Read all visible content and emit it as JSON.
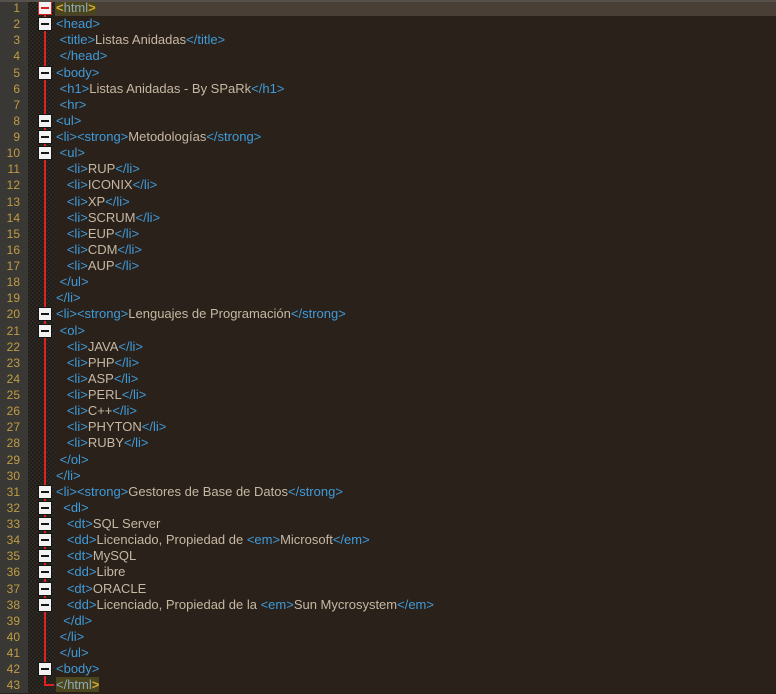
{
  "editor": {
    "language": "HTML",
    "total_lines": 43,
    "colors": {
      "background": "#2A211B",
      "current_line_background": "#4A3F36",
      "gutter_background": "#3A3834",
      "line_number_color": "#BF9D43",
      "tag_color": "#3F9BD9",
      "text_color": "#C6B8A2",
      "fold_guide_red": "#DE2222",
      "matched_tag_background": "#4A451C",
      "matched_tag_bracket_color": "#D2A92F",
      "matched_tag_name_color": "#8FA9BA",
      "top_edge_color": "#57514B"
    },
    "icons": {
      "fold_collapse_icon": "minus-box",
      "fold_guide_icon": "vertical-line",
      "fold_tail_icon": "corner-line"
    },
    "lines": [
      {
        "n": 1,
        "fold": "boxRed",
        "current": true,
        "segments": [
          {
            "t": "<",
            "c": "mb"
          },
          {
            "t": "html",
            "c": "mn"
          },
          {
            "t": ">",
            "c": "mb"
          }
        ]
      },
      {
        "n": 2,
        "fold": "box",
        "segments": [
          {
            "t": "<head>",
            "c": "tag"
          }
        ]
      },
      {
        "n": 3,
        "fold": "line",
        "segments": [
          {
            "t": " ",
            "c": "txt"
          },
          {
            "t": "<title>",
            "c": "tag"
          },
          {
            "t": "Listas Anidadas",
            "c": "txt"
          },
          {
            "t": "</title>",
            "c": "tag"
          }
        ]
      },
      {
        "n": 4,
        "fold": "line",
        "segments": [
          {
            "t": " ",
            "c": "txt"
          },
          {
            "t": "</head>",
            "c": "tag"
          }
        ]
      },
      {
        "n": 5,
        "fold": "box",
        "segments": [
          {
            "t": "<body>",
            "c": "tag"
          }
        ]
      },
      {
        "n": 6,
        "fold": "line",
        "segments": [
          {
            "t": " ",
            "c": "txt"
          },
          {
            "t": "<h1>",
            "c": "tag"
          },
          {
            "t": "Listas Anidadas - By SPaRk",
            "c": "txt"
          },
          {
            "t": "</h1>",
            "c": "tag"
          }
        ]
      },
      {
        "n": 7,
        "fold": "line",
        "segments": [
          {
            "t": " ",
            "c": "txt"
          },
          {
            "t": "<hr>",
            "c": "tag"
          }
        ]
      },
      {
        "n": 8,
        "fold": "box",
        "segments": [
          {
            "t": "<ul>",
            "c": "tag"
          }
        ]
      },
      {
        "n": 9,
        "fold": "box",
        "segments": [
          {
            "t": "<li><strong>",
            "c": "tag"
          },
          {
            "t": "Metodologías",
            "c": "txt"
          },
          {
            "t": "</strong>",
            "c": "tag"
          }
        ]
      },
      {
        "n": 10,
        "fold": "box",
        "segments": [
          {
            "t": " ",
            "c": "txt"
          },
          {
            "t": "<ul>",
            "c": "tag"
          }
        ]
      },
      {
        "n": 11,
        "fold": "line",
        "segments": [
          {
            "t": "   ",
            "c": "txt"
          },
          {
            "t": "<li>",
            "c": "tag"
          },
          {
            "t": "RUP",
            "c": "txt"
          },
          {
            "t": "</li>",
            "c": "tag"
          }
        ]
      },
      {
        "n": 12,
        "fold": "line",
        "segments": [
          {
            "t": "   ",
            "c": "txt"
          },
          {
            "t": "<li>",
            "c": "tag"
          },
          {
            "t": "ICONIX",
            "c": "txt"
          },
          {
            "t": "</li>",
            "c": "tag"
          }
        ]
      },
      {
        "n": 13,
        "fold": "line",
        "segments": [
          {
            "t": "   ",
            "c": "txt"
          },
          {
            "t": "<li>",
            "c": "tag"
          },
          {
            "t": "XP",
            "c": "txt"
          },
          {
            "t": "</li>",
            "c": "tag"
          }
        ]
      },
      {
        "n": 14,
        "fold": "line",
        "segments": [
          {
            "t": "   ",
            "c": "txt"
          },
          {
            "t": "<li>",
            "c": "tag"
          },
          {
            "t": "SCRUM",
            "c": "txt"
          },
          {
            "t": "</li>",
            "c": "tag"
          }
        ]
      },
      {
        "n": 15,
        "fold": "line",
        "segments": [
          {
            "t": "   ",
            "c": "txt"
          },
          {
            "t": "<li>",
            "c": "tag"
          },
          {
            "t": "EUP",
            "c": "txt"
          },
          {
            "t": "</li>",
            "c": "tag"
          }
        ]
      },
      {
        "n": 16,
        "fold": "line",
        "segments": [
          {
            "t": "   ",
            "c": "txt"
          },
          {
            "t": "<li>",
            "c": "tag"
          },
          {
            "t": "CDM",
            "c": "txt"
          },
          {
            "t": "</li>",
            "c": "tag"
          }
        ]
      },
      {
        "n": 17,
        "fold": "line",
        "segments": [
          {
            "t": "   ",
            "c": "txt"
          },
          {
            "t": "<li>",
            "c": "tag"
          },
          {
            "t": "AUP",
            "c": "txt"
          },
          {
            "t": "</li>",
            "c": "tag"
          }
        ]
      },
      {
        "n": 18,
        "fold": "line",
        "segments": [
          {
            "t": " ",
            "c": "txt"
          },
          {
            "t": "</ul>",
            "c": "tag"
          }
        ]
      },
      {
        "n": 19,
        "fold": "line",
        "segments": [
          {
            "t": "</li>",
            "c": "tag"
          }
        ]
      },
      {
        "n": 20,
        "fold": "box",
        "segments": [
          {
            "t": "<li><strong>",
            "c": "tag"
          },
          {
            "t": "Lenguajes de Programación",
            "c": "txt"
          },
          {
            "t": "</strong>",
            "c": "tag"
          }
        ]
      },
      {
        "n": 21,
        "fold": "box",
        "segments": [
          {
            "t": " ",
            "c": "txt"
          },
          {
            "t": "<ol>",
            "c": "tag"
          }
        ]
      },
      {
        "n": 22,
        "fold": "line",
        "segments": [
          {
            "t": "   ",
            "c": "txt"
          },
          {
            "t": "<li>",
            "c": "tag"
          },
          {
            "t": "JAVA",
            "c": "txt"
          },
          {
            "t": "</li>",
            "c": "tag"
          }
        ]
      },
      {
        "n": 23,
        "fold": "line",
        "segments": [
          {
            "t": "   ",
            "c": "txt"
          },
          {
            "t": "<li>",
            "c": "tag"
          },
          {
            "t": "PHP",
            "c": "txt"
          },
          {
            "t": "</li>",
            "c": "tag"
          }
        ]
      },
      {
        "n": 24,
        "fold": "line",
        "segments": [
          {
            "t": "   ",
            "c": "txt"
          },
          {
            "t": "<li>",
            "c": "tag"
          },
          {
            "t": "ASP",
            "c": "txt"
          },
          {
            "t": "</li>",
            "c": "tag"
          }
        ]
      },
      {
        "n": 25,
        "fold": "line",
        "segments": [
          {
            "t": "   ",
            "c": "txt"
          },
          {
            "t": "<li>",
            "c": "tag"
          },
          {
            "t": "PERL",
            "c": "txt"
          },
          {
            "t": "</li>",
            "c": "tag"
          }
        ]
      },
      {
        "n": 26,
        "fold": "line",
        "segments": [
          {
            "t": "   ",
            "c": "txt"
          },
          {
            "t": "<li>",
            "c": "tag"
          },
          {
            "t": "C++",
            "c": "txt"
          },
          {
            "t": "</li>",
            "c": "tag"
          }
        ]
      },
      {
        "n": 27,
        "fold": "line",
        "segments": [
          {
            "t": "   ",
            "c": "txt"
          },
          {
            "t": "<li>",
            "c": "tag"
          },
          {
            "t": "PHYTON",
            "c": "txt"
          },
          {
            "t": "</li>",
            "c": "tag"
          }
        ]
      },
      {
        "n": 28,
        "fold": "line",
        "segments": [
          {
            "t": "   ",
            "c": "txt"
          },
          {
            "t": "<li>",
            "c": "tag"
          },
          {
            "t": "RUBY",
            "c": "txt"
          },
          {
            "t": "</li>",
            "c": "tag"
          }
        ]
      },
      {
        "n": 29,
        "fold": "line",
        "segments": [
          {
            "t": " ",
            "c": "txt"
          },
          {
            "t": "</ol>",
            "c": "tag"
          }
        ]
      },
      {
        "n": 30,
        "fold": "line",
        "segments": [
          {
            "t": "</li>",
            "c": "tag"
          }
        ]
      },
      {
        "n": 31,
        "fold": "box",
        "segments": [
          {
            "t": "<li><strong>",
            "c": "tag"
          },
          {
            "t": "Gestores de Base de Datos",
            "c": "txt"
          },
          {
            "t": "</strong>",
            "c": "tag"
          }
        ]
      },
      {
        "n": 32,
        "fold": "box",
        "segments": [
          {
            "t": "  ",
            "c": "txt"
          },
          {
            "t": "<dl>",
            "c": "tag"
          }
        ]
      },
      {
        "n": 33,
        "fold": "box",
        "segments": [
          {
            "t": "   ",
            "c": "txt"
          },
          {
            "t": "<dt>",
            "c": "tag"
          },
          {
            "t": "SQL Server",
            "c": "txt"
          }
        ]
      },
      {
        "n": 34,
        "fold": "box",
        "segments": [
          {
            "t": "   ",
            "c": "txt"
          },
          {
            "t": "<dd>",
            "c": "tag"
          },
          {
            "t": "Licenciado, Propiedad de ",
            "c": "txt"
          },
          {
            "t": "<em>",
            "c": "tag"
          },
          {
            "t": "Microsoft",
            "c": "txt"
          },
          {
            "t": "</em>",
            "c": "tag"
          }
        ]
      },
      {
        "n": 35,
        "fold": "box",
        "segments": [
          {
            "t": "   ",
            "c": "txt"
          },
          {
            "t": "<dt>",
            "c": "tag"
          },
          {
            "t": "MySQL",
            "c": "txt"
          }
        ]
      },
      {
        "n": 36,
        "fold": "box",
        "segments": [
          {
            "t": "   ",
            "c": "txt"
          },
          {
            "t": "<dd>",
            "c": "tag"
          },
          {
            "t": "Libre",
            "c": "txt"
          }
        ]
      },
      {
        "n": 37,
        "fold": "box",
        "segments": [
          {
            "t": "   ",
            "c": "txt"
          },
          {
            "t": "<dt>",
            "c": "tag"
          },
          {
            "t": "ORACLE",
            "c": "txt"
          }
        ]
      },
      {
        "n": 38,
        "fold": "box",
        "segments": [
          {
            "t": "   ",
            "c": "txt"
          },
          {
            "t": "<dd>",
            "c": "tag"
          },
          {
            "t": "Licenciado, Propiedad de la ",
            "c": "txt"
          },
          {
            "t": "<em>",
            "c": "tag"
          },
          {
            "t": "Sun Mycrosystem",
            "c": "txt"
          },
          {
            "t": "</em>",
            "c": "tag"
          }
        ]
      },
      {
        "n": 39,
        "fold": "line",
        "segments": [
          {
            "t": "  ",
            "c": "txt"
          },
          {
            "t": "</dl>",
            "c": "tag"
          }
        ]
      },
      {
        "n": 40,
        "fold": "line",
        "segments": [
          {
            "t": " ",
            "c": "txt"
          },
          {
            "t": "</li>",
            "c": "tag"
          }
        ]
      },
      {
        "n": 41,
        "fold": "line",
        "segments": [
          {
            "t": " ",
            "c": "txt"
          },
          {
            "t": "</ul>",
            "c": "tag"
          }
        ]
      },
      {
        "n": 42,
        "fold": "box",
        "segments": [
          {
            "t": "<body>",
            "c": "tag"
          }
        ]
      },
      {
        "n": 43,
        "fold": "corner",
        "segments": [
          {
            "t": "</html",
            "c": "mn"
          },
          {
            "t": ">",
            "c": "mb"
          }
        ]
      }
    ]
  }
}
